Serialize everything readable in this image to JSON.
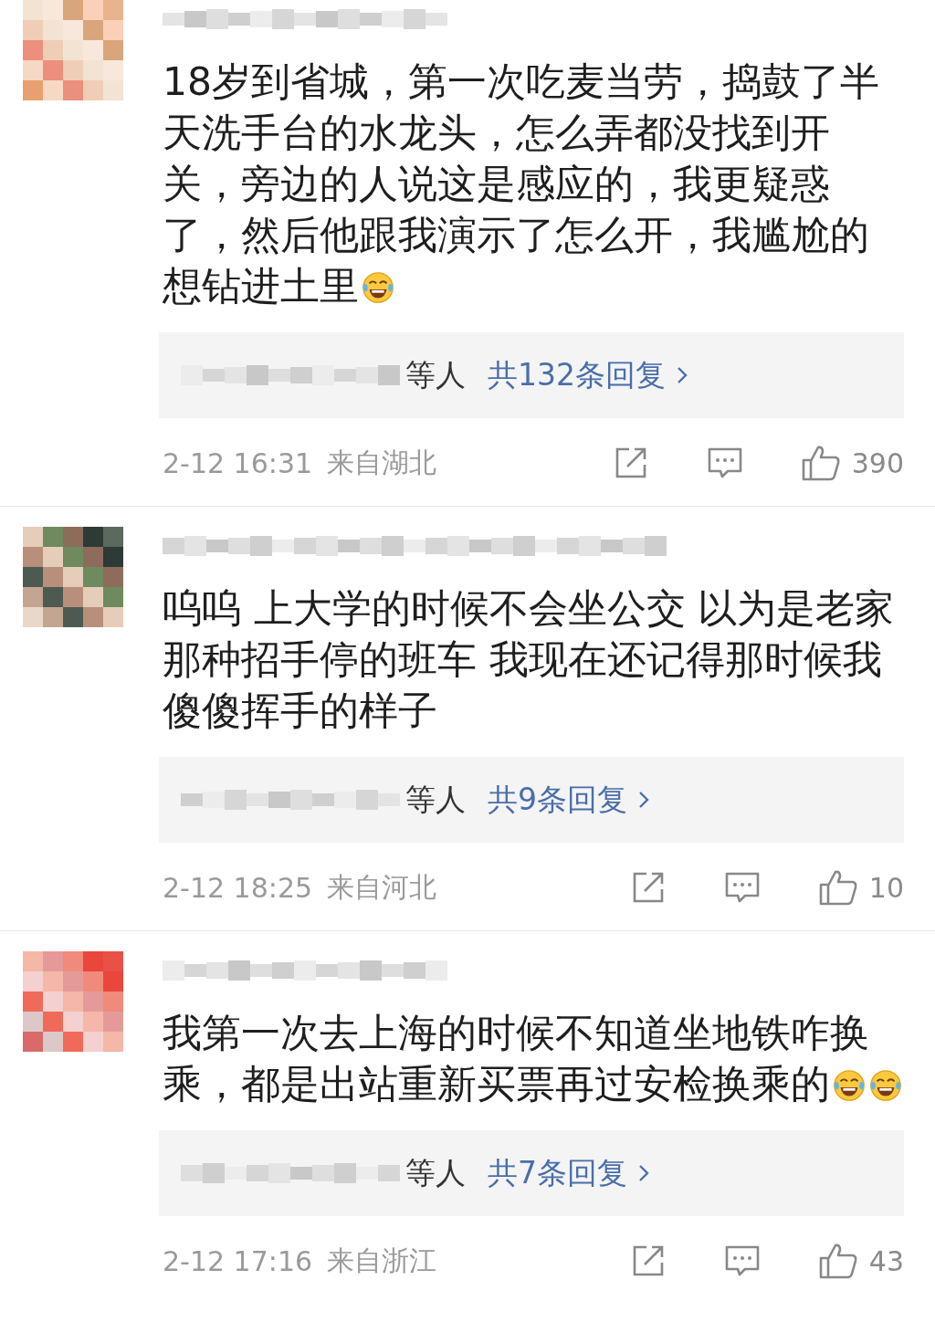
{
  "comments": [
    {
      "text": "18岁到省城，第一次吃麦当劳，捣鼓了半天洗手台的水龙头，怎么弄都没找到开关，旁边的人说这是感应的，我更疑惑了，然后他跟我演示了怎么开，我尴尬的想钻进土里",
      "emojis": [
        {
          "kind": "laughing"
        }
      ],
      "replies": {
        "suffix": "等人",
        "link": "共132条回复"
      },
      "time": "2-12 16:31",
      "location": "来自湖北",
      "likes": "390"
    },
    {
      "text": "呜呜 上大学的时候不会坐公交 以为是老家那种招手停的班车 我现在还记得那时候我傻傻挥手的样子",
      "replies": {
        "suffix": "等人",
        "link": "共9条回复"
      },
      "time": "2-12 18:25",
      "location": "来自河北",
      "likes": "10"
    },
    {
      "text": "我第一次去上海的时候不知道坐地铁咋换乘，都是出站重新买票再过安检换乘的",
      "emojis": [
        {
          "kind": "laughing"
        },
        {
          "kind": "laughing"
        }
      ],
      "replies": {
        "suffix": "等人",
        "link": "共7条回复"
      },
      "time": "2-12 17:16",
      "location": "来自浙江",
      "likes": "43"
    }
  ]
}
